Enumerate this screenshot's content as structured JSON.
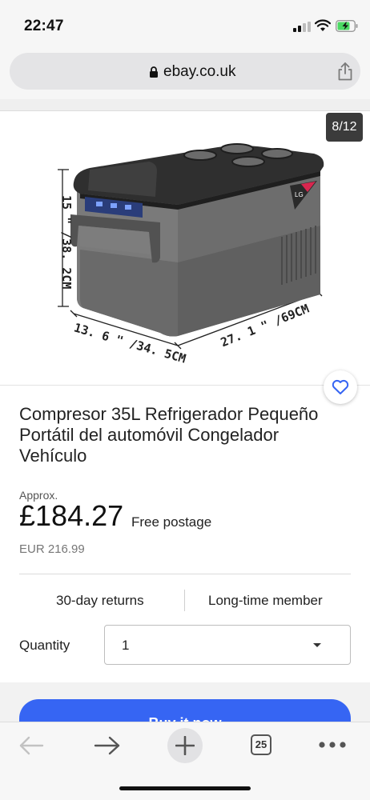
{
  "status_bar": {
    "time": "22:47"
  },
  "browser": {
    "url": "ebay.co.uk"
  },
  "gallery": {
    "counter": "8/12",
    "dimension_height": "15 \" /38. 2CM",
    "dimension_depth": "13. 6 \" /34. 5CM",
    "dimension_width": "27. 1 \" /69CM",
    "brand_badge": "LG"
  },
  "listing": {
    "title": "Compresor 35L Refrigerador Pequeño Portátil del automóvil Congelador Vehículo",
    "approx_label": "Approx.",
    "price": "£184.27",
    "postage": "Free postage",
    "converted_price": "EUR 216.99",
    "returns": "30-day returns",
    "seller_badge": "Long-time member",
    "quantity_label": "Quantity",
    "quantity_value": "1",
    "buy_now_label": "Buy it now"
  },
  "toolbar": {
    "tabs_count": "25"
  },
  "colors": {
    "accent_blue": "#3665f3",
    "heart_blue": "#3665f3",
    "badge_bg": "#3b3b3b"
  }
}
